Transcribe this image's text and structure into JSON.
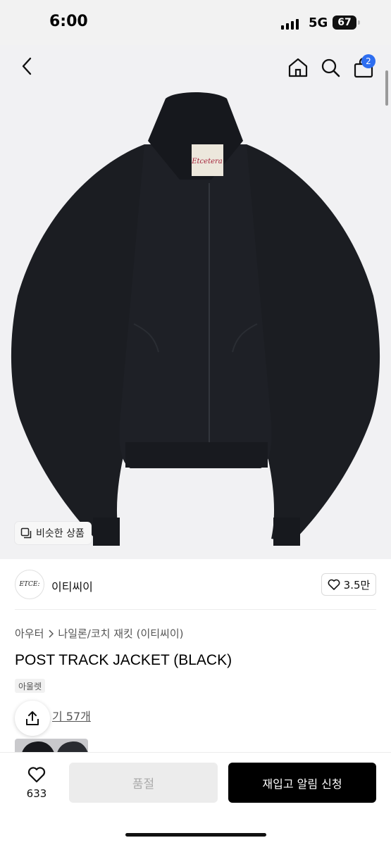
{
  "status": {
    "time": "6:00",
    "network": "5G",
    "battery": "67"
  },
  "header": {
    "cart_count": "2",
    "similar_label": "비슷한 상품"
  },
  "brand": {
    "logo_text": "ETCE:",
    "name": "이티씨이",
    "likes": "3.5만"
  },
  "product": {
    "category_root": "아우터",
    "category_path": "나일론/코치 재킷 (이티씨이)",
    "title": "POST TRACK JACKET (BLACK)",
    "badge": "아울렛",
    "review_partial": "기 57개"
  },
  "bottom": {
    "wish_count": "633",
    "soldout_label": "품절",
    "restock_label": "재입고 알림 신청"
  },
  "colors": {
    "accent": "#2e6ef0",
    "jacket": "#1c1e24",
    "primary_button": "#000000"
  },
  "icons": {
    "back": "chevron-left-icon",
    "home": "home-icon",
    "search": "search-icon",
    "cart": "bag-icon",
    "share": "share-icon",
    "heart": "heart-icon",
    "similar": "similar-icon"
  }
}
